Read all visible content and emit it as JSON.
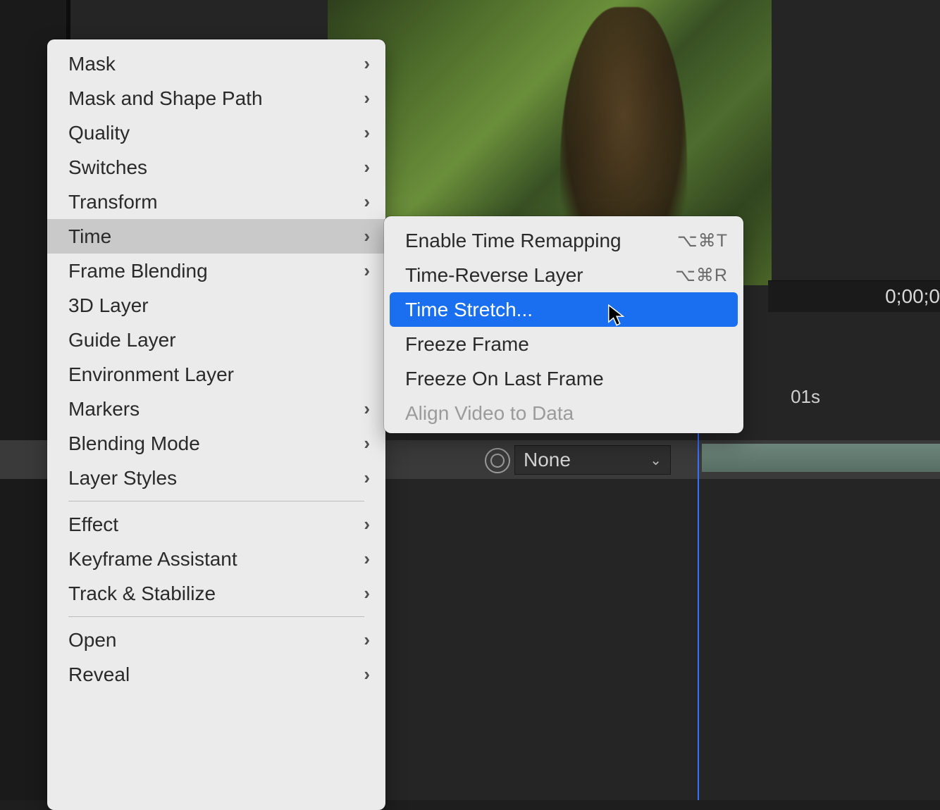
{
  "background": {
    "timecode": "0;00;0",
    "ruler_mark": "01s",
    "parent_dropdown": "None"
  },
  "context_menu": {
    "items": [
      {
        "label": "Mask",
        "has_sub": true,
        "sep_after": false
      },
      {
        "label": "Mask and Shape Path",
        "has_sub": true,
        "sep_after": false
      },
      {
        "label": "Quality",
        "has_sub": true,
        "sep_after": false
      },
      {
        "label": "Switches",
        "has_sub": true,
        "sep_after": false
      },
      {
        "label": "Transform",
        "has_sub": true,
        "sep_after": false
      },
      {
        "label": "Time",
        "has_sub": true,
        "sep_after": false,
        "hovered": true
      },
      {
        "label": "Frame Blending",
        "has_sub": true,
        "sep_after": false
      },
      {
        "label": "3D Layer",
        "has_sub": false,
        "sep_after": false
      },
      {
        "label": "Guide Layer",
        "has_sub": false,
        "sep_after": false
      },
      {
        "label": "Environment Layer",
        "has_sub": false,
        "sep_after": false
      },
      {
        "label": "Markers",
        "has_sub": true,
        "sep_after": false
      },
      {
        "label": "Blending Mode",
        "has_sub": true,
        "sep_after": false
      },
      {
        "label": "Layer Styles",
        "has_sub": true,
        "sep_after": true
      },
      {
        "label": "Effect",
        "has_sub": true,
        "sep_after": false
      },
      {
        "label": "Keyframe Assistant",
        "has_sub": true,
        "sep_after": false
      },
      {
        "label": "Track & Stabilize",
        "has_sub": true,
        "sep_after": true
      },
      {
        "label": "Open",
        "has_sub": true,
        "sep_after": false
      },
      {
        "label": "Reveal",
        "has_sub": true,
        "sep_after": false
      }
    ]
  },
  "submenu": {
    "items": [
      {
        "label": "Enable Time Remapping",
        "shortcut": "⌥⌘T"
      },
      {
        "label": "Time-Reverse Layer",
        "shortcut": "⌥⌘R"
      },
      {
        "label": "Time Stretch...",
        "selected": true
      },
      {
        "label": "Freeze Frame"
      },
      {
        "label": "Freeze On Last Frame"
      },
      {
        "label": "Align Video to Data",
        "disabled": true
      }
    ]
  }
}
